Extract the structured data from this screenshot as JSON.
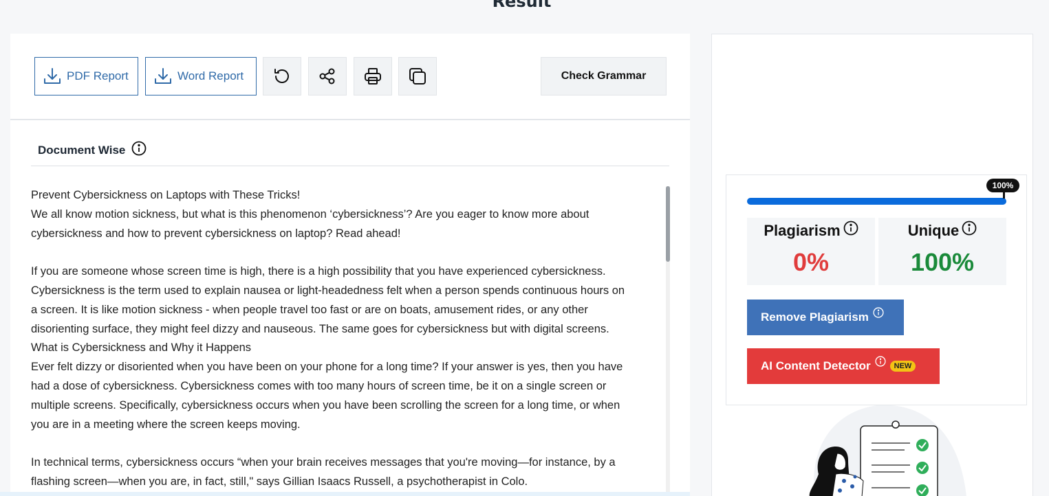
{
  "page": {
    "title": "Result"
  },
  "toolbar": {
    "pdf_label": "PDF Report",
    "word_label": "Word Report",
    "grammar_label": "Check Grammar",
    "icons": [
      "reload-icon",
      "share-icon",
      "print-icon",
      "copy-icon"
    ]
  },
  "document": {
    "header": "Document Wise",
    "lines": [
      "Prevent Cybersickness on Laptops with These Tricks!",
      "We all know motion sickness, but what is this phenomenon ‘cybersickness’? Are you eager to know more about",
      "cybersickness and how to prevent cybersickness on laptop? Read ahead!",
      "",
      "If you are someone whose screen time is high, there is a high possibility that you have experienced cybersickness.",
      "Cybersickness is the term used to explain nausea or light-headedness felt when a person spends continuous hours on",
      "a screen. It is like motion sickness - when people travel too fast or are on boats, amusement rides, or any other",
      "disorienting surface, they might feel dizzy and nauseous. The same goes for cybersickness but with digital screens.",
      "What is Cybersickness and Why it Happens",
      "Ever felt dizzy or disoriented when you have been on your phone for a long time? If your answer is yes, then you have",
      "had a dose of cybersickness. Cybersickness comes with too many hours of screen time, be it on a single screen or",
      "multiple screens. Specifically, cybersickness occurs when you have been scrolling the screen for a long time, or when",
      "you are in a meeting where the screen keeps moving.",
      "",
      "In technical terms, cybersickness occurs “when your brain receives messages that you're moving—for instance, by a",
      "flashing screen—when you are, in fact, still,\" says Gillian Isaacs Russell, a psychotherapist in Colo."
    ]
  },
  "result": {
    "progress_percent": 100,
    "progress_label": "100%",
    "plagiarism_label": "Plagiarism",
    "plagiarism_value": "0%",
    "unique_label": "Unique",
    "unique_value": "100%",
    "remove_label": "Remove Plagiarism",
    "ai_label": "AI Content Detector",
    "new_badge": "NEW"
  },
  "colors": {
    "accent": "#2f6aa8",
    "plagiarism": "#e03c3c",
    "unique": "#1a8a3a",
    "progress": "#0a6bdc",
    "remove_button": "#3f72b8",
    "ai_button": "#e33b3b"
  }
}
